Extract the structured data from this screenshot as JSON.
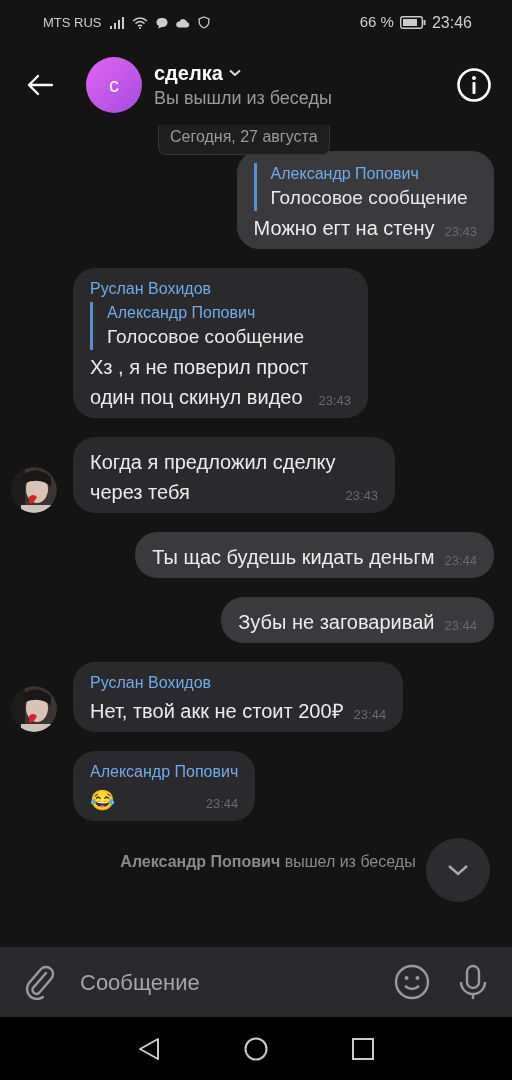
{
  "status_bar": {
    "carrier": "MTS RUS",
    "battery": "66 %",
    "time": "23:46"
  },
  "header": {
    "avatar_letter": "с",
    "title": "сделка",
    "subtitle": "Вы вышли из беседы"
  },
  "date_divider": "Сегодня, 27 августа",
  "messages": [
    {
      "outgoing": true,
      "reply": {
        "author": "Александр Попович",
        "text": "Голосовое сообщение"
      },
      "text": "Можно егт на стену",
      "time": "23:43"
    },
    {
      "outgoing": false,
      "author": "Руслан Вохидов",
      "reply": {
        "author": "Александр Попович",
        "text": "Голосовое сообщение"
      },
      "text": "Хз , я не поверил прост\nодин поц скинул видео",
      "time": "23:43",
      "avatar": false
    },
    {
      "outgoing": false,
      "text": "Когда я предложил сделку\nчерез тебя",
      "time": "23:43",
      "avatar": true
    },
    {
      "outgoing": true,
      "text": "Ты щас будешь кидать деньгм",
      "time": "23:44"
    },
    {
      "outgoing": true,
      "text": "Зубы не заговаривай",
      "time": "23:44"
    },
    {
      "outgoing": false,
      "author": "Руслан Вохидов",
      "text": "Нет, твой акк не стоит 200₽",
      "time": "23:44",
      "avatar": true
    },
    {
      "outgoing": false,
      "author": "Александр Попович",
      "text": "😂",
      "time": "23:44",
      "avatar": false
    }
  ],
  "service_message": "**Александр Попович** вышел из беседы",
  "composer": {
    "placeholder": "Сообщение"
  }
}
